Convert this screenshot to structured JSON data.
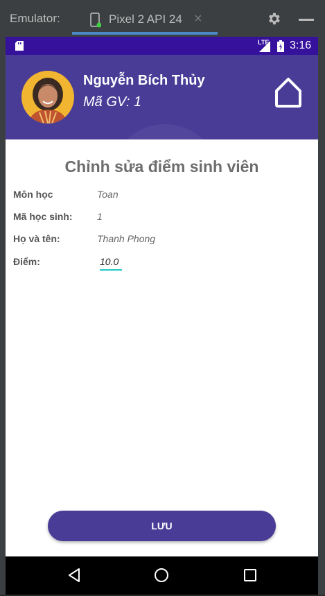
{
  "emulator": {
    "title": "Emulator:",
    "tab_label": "Pixel 2 API 24",
    "tab_close": "×",
    "icons": [
      "phone-icon",
      "close-icon",
      "gear-icon",
      "minimize-icon"
    ]
  },
  "status_bar": {
    "network": "LTE",
    "time": "3:16",
    "icons": [
      "sd-card-icon",
      "signal-icon",
      "battery-icon"
    ]
  },
  "header": {
    "teacher_name": "Nguyễn Bích Thủy",
    "teacher_code": "Mã GV: 1",
    "icons": [
      "avatar",
      "home-icon"
    ]
  },
  "form": {
    "title": "Chỉnh sửa điểm sinh viên",
    "fields": [
      {
        "label": "Môn học",
        "value": "Toan"
      },
      {
        "label": "Mã học sinh:",
        "value": "1"
      },
      {
        "label": "Họ và tên:",
        "value": "Thanh Phong"
      }
    ],
    "score_label": "Điểm:",
    "score_value": "10.0"
  },
  "save_button": "LƯU",
  "nav_bar": {
    "icons": [
      "back-icon",
      "home-circle-icon",
      "recent-apps-icon"
    ]
  },
  "colors": {
    "status_bar": "#35119c",
    "header": "#493c97",
    "button": "#493c97",
    "input_underline": "#1ec8c8",
    "title_text": "#6d6d6d"
  }
}
